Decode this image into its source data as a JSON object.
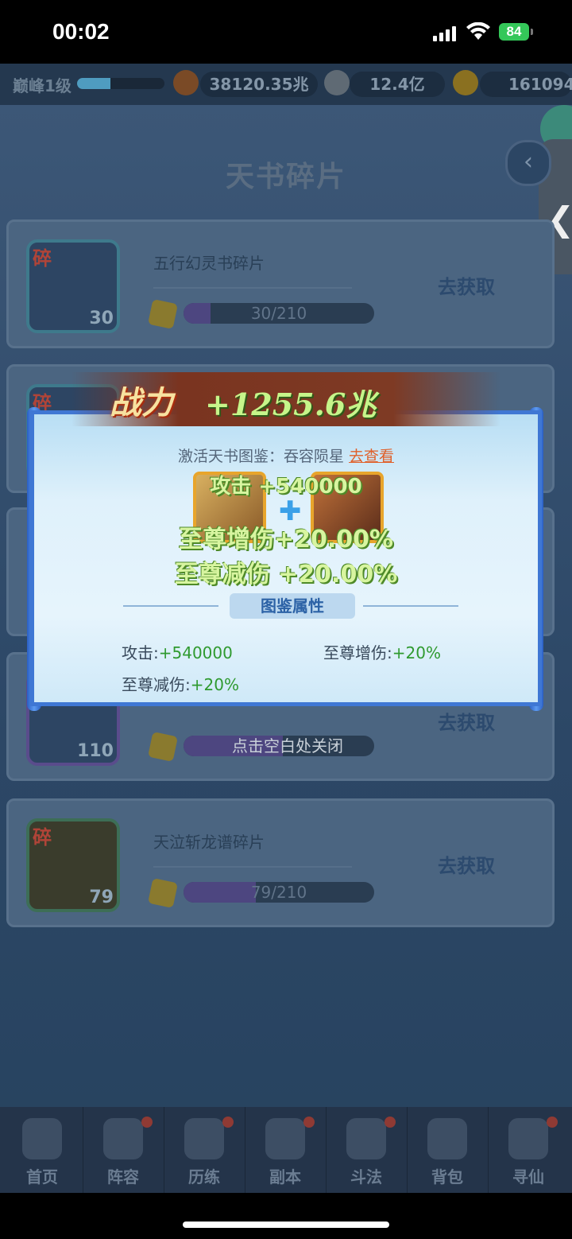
{
  "status": {
    "time": "00:02",
    "battery": "84"
  },
  "resources": {
    "level": "巅峰1级",
    "power": "38120.35兆",
    "coins": "12.4亿",
    "gold": "161094"
  },
  "title": "天书碎片",
  "back_icon": "‹",
  "side_tab_icon": "❮",
  "cards": [
    {
      "tag": "碎",
      "name": "五行幻灵书碎片",
      "count": "30",
      "progress_text": "30/210",
      "progress": 0.14,
      "action": "去获取"
    },
    {
      "tag": "碎"
    },
    {
      "tag": ""
    },
    {
      "count": "110",
      "action": "去获取"
    },
    {
      "tag": "碎",
      "name": "天泣斩龙谱碎片",
      "count": "79",
      "progress_text": "79/210",
      "progress": 0.38,
      "action": "去获取"
    }
  ],
  "popup": {
    "power_label": "战力",
    "power_value": "+1255.6兆",
    "activate_text": "激活天书图鉴：吞容陨星",
    "view_link": "去查看",
    "float_attack": "攻击 +540000",
    "float_dmg_up": "至尊增伤+20.00%",
    "float_dmg_down": "至尊减伤 +20.00%",
    "section_title": "图鉴属性",
    "attrs": [
      {
        "label": "攻击:",
        "value": "+540000"
      },
      {
        "label": "至尊增伤:",
        "value": "+20%"
      },
      {
        "label": "至尊减伤:",
        "value": "+20%"
      }
    ]
  },
  "close_hint": "点击空白处关闭",
  "tabs": [
    "首页",
    "阵容",
    "历练",
    "副本",
    "斗法",
    "背包",
    "寻仙"
  ]
}
